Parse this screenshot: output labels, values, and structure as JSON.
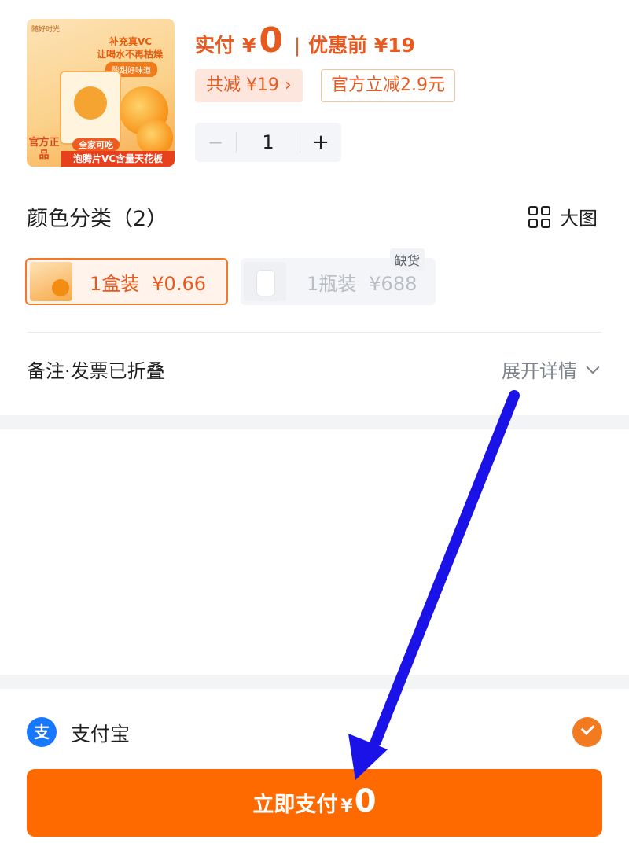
{
  "product": {
    "thumbnail": {
      "brand": "随好时光",
      "headline_1": "补充真VC",
      "headline_2": "让喝水不再枯燥",
      "headline_3": "酸甜好味道",
      "badge_left": "官方正品",
      "badge_top": "全家可吃",
      "badge_bar": "泡腾片VC含量天花板"
    },
    "pay_label": "实付",
    "currency": "¥",
    "pay_amount": "0",
    "separator": "|",
    "before_label": "优惠前 ¥19",
    "reduce_tag": "共减 ¥19 ›",
    "official_tag": "官方立减2.9元",
    "quantity": {
      "minus": "−",
      "value": "1",
      "plus": "+"
    }
  },
  "color_section": {
    "title": "颜色分类（2）",
    "big_view": "大图",
    "options": [
      {
        "label": "1盒装",
        "price": "¥0.66",
        "selected": true
      },
      {
        "label": "1瓶装",
        "price": "¥688",
        "disabled": true,
        "badge": "缺货"
      }
    ]
  },
  "notes": {
    "label": "备注·发票已折叠",
    "expand": "展开详情"
  },
  "payment": {
    "method_icon_glyph": "支",
    "method": "支付宝",
    "checked": true
  },
  "pay_button": {
    "label": "立即支付",
    "currency": "¥",
    "amount": "0"
  },
  "colors": {
    "accent": "#ff6a00",
    "price_text": "#e8591f",
    "annotation_arrow": "#1a12e6",
    "alipay_blue": "#1677ff"
  }
}
